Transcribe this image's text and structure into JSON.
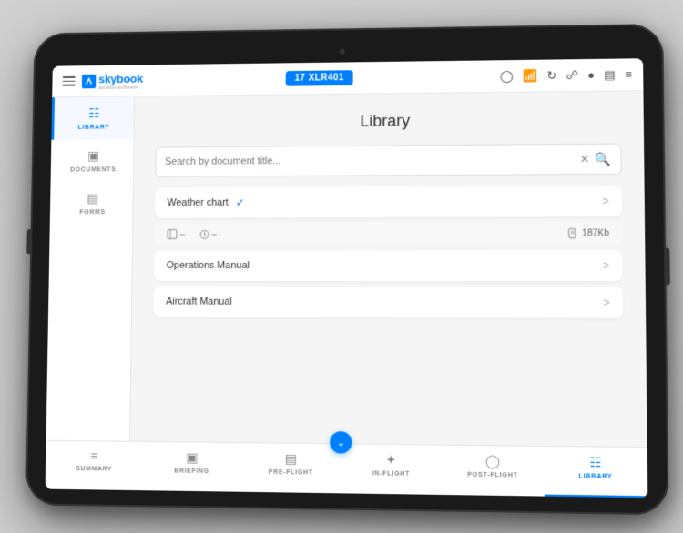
{
  "brand": {
    "logo_label": "skybook",
    "tagline": "aviation software"
  },
  "header": {
    "flight_id": "17 XLR401",
    "hamburger_label": "menu"
  },
  "status_icons": [
    "person-icon",
    "wifi-icon",
    "refresh-icon",
    "bookmark-icon",
    "bell-icon",
    "camera-icon",
    "settings-icon"
  ],
  "sidebar": {
    "items": [
      {
        "id": "library",
        "label": "LIBRARY",
        "active": true
      },
      {
        "id": "documents",
        "label": "DOCUMENTS",
        "active": false
      },
      {
        "id": "forms",
        "label": "FORMS",
        "active": false
      }
    ]
  },
  "content": {
    "title": "Library",
    "search_placeholder": "Search by document title...",
    "documents": [
      {
        "id": "weather-chart",
        "title": "Weather chart",
        "checked": true,
        "has_subrow": true,
        "subrow": {
          "icon1": "⊟",
          "dash": "–",
          "clock": "–",
          "file_size": "187Kb"
        }
      },
      {
        "id": "operations-manual",
        "title": "Operations Manual",
        "checked": false,
        "has_subrow": false
      },
      {
        "id": "aircraft-manual",
        "title": "Aircraft Manual",
        "checked": false,
        "has_subrow": false
      }
    ]
  },
  "bottom_nav": {
    "items": [
      {
        "id": "summary",
        "label": "SUMMARY",
        "active": false
      },
      {
        "id": "briefing",
        "label": "BRIEFING",
        "active": false
      },
      {
        "id": "pre-flight",
        "label": "PRE-FLIGHT",
        "active": false
      },
      {
        "id": "in-flight",
        "label": "IN-FLIGHT",
        "active": false
      },
      {
        "id": "post-flight",
        "label": "POST-FLIGHT",
        "active": false
      },
      {
        "id": "library",
        "label": "LIBRARY",
        "active": true
      }
    ]
  }
}
